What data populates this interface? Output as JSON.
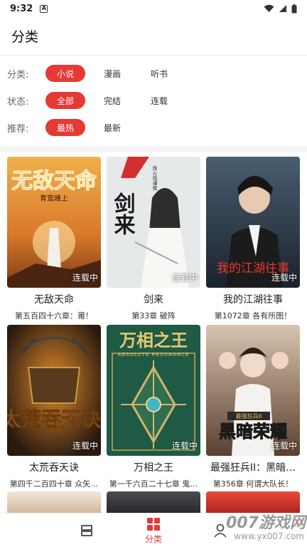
{
  "status_bar": {
    "time": "9:32",
    "notif_icon": "A"
  },
  "header": {
    "title": "分类"
  },
  "filters": {
    "category": {
      "label": "分类:",
      "options": [
        "小说",
        "漫画",
        "听书"
      ],
      "selected": "小说"
    },
    "status": {
      "label": "状态:",
      "options": [
        "全部",
        "完结",
        "连载"
      ],
      "selected": "全部"
    },
    "recommend": {
      "label": "推荐:",
      "options": [
        "最热",
        "最新"
      ],
      "selected": "最热"
    }
  },
  "books": [
    {
      "title": "无敌天命",
      "chapter": "第五百四十六章：莆！",
      "status": "连载中",
      "cover_text": "无敌天命",
      "cover_sub": "青鸾峰上",
      "cover_color": "#d9782a"
    },
    {
      "title": "剑来",
      "chapter": "第33章 破阵",
      "status": "连载中",
      "cover_text": "剑来",
      "cover_sub": "烽火戏诸侯",
      "cover_color": "#cfd6da"
    },
    {
      "title": "我的江湖往事",
      "chapter": "第1072章 各有所图！",
      "status": "连载中",
      "cover_text": "我的江湖往事",
      "cover_sub": "",
      "cover_color": "#2b3846"
    },
    {
      "title": "太荒吞天诀",
      "chapter": "第四千二百四十章 众矢…",
      "status": "连载中",
      "cover_text": "太荒吞天诀",
      "cover_sub": "",
      "cover_color": "#3a2a1e"
    },
    {
      "title": "万相之王",
      "chapter": "第一千六百二十七章 鬼…",
      "status": "连载中",
      "cover_text": "万相之王",
      "cover_sub": "ABSOLUTE RESONANCE",
      "cover_color": "#1f5a44"
    },
    {
      "title": "最强狂兵II：黑暗…",
      "chapter": "第356章 何谓大队长！",
      "status": "连载中",
      "cover_text": "黑暗荣耀",
      "cover_sub": "最强狂兵II",
      "cover_color": "#8a6a52"
    }
  ],
  "tabbar": {
    "active_label": "分类"
  },
  "watermark": {
    "text": "007游戏网",
    "url": "www.yx007.com"
  },
  "colors": {
    "accent": "#e53935"
  }
}
